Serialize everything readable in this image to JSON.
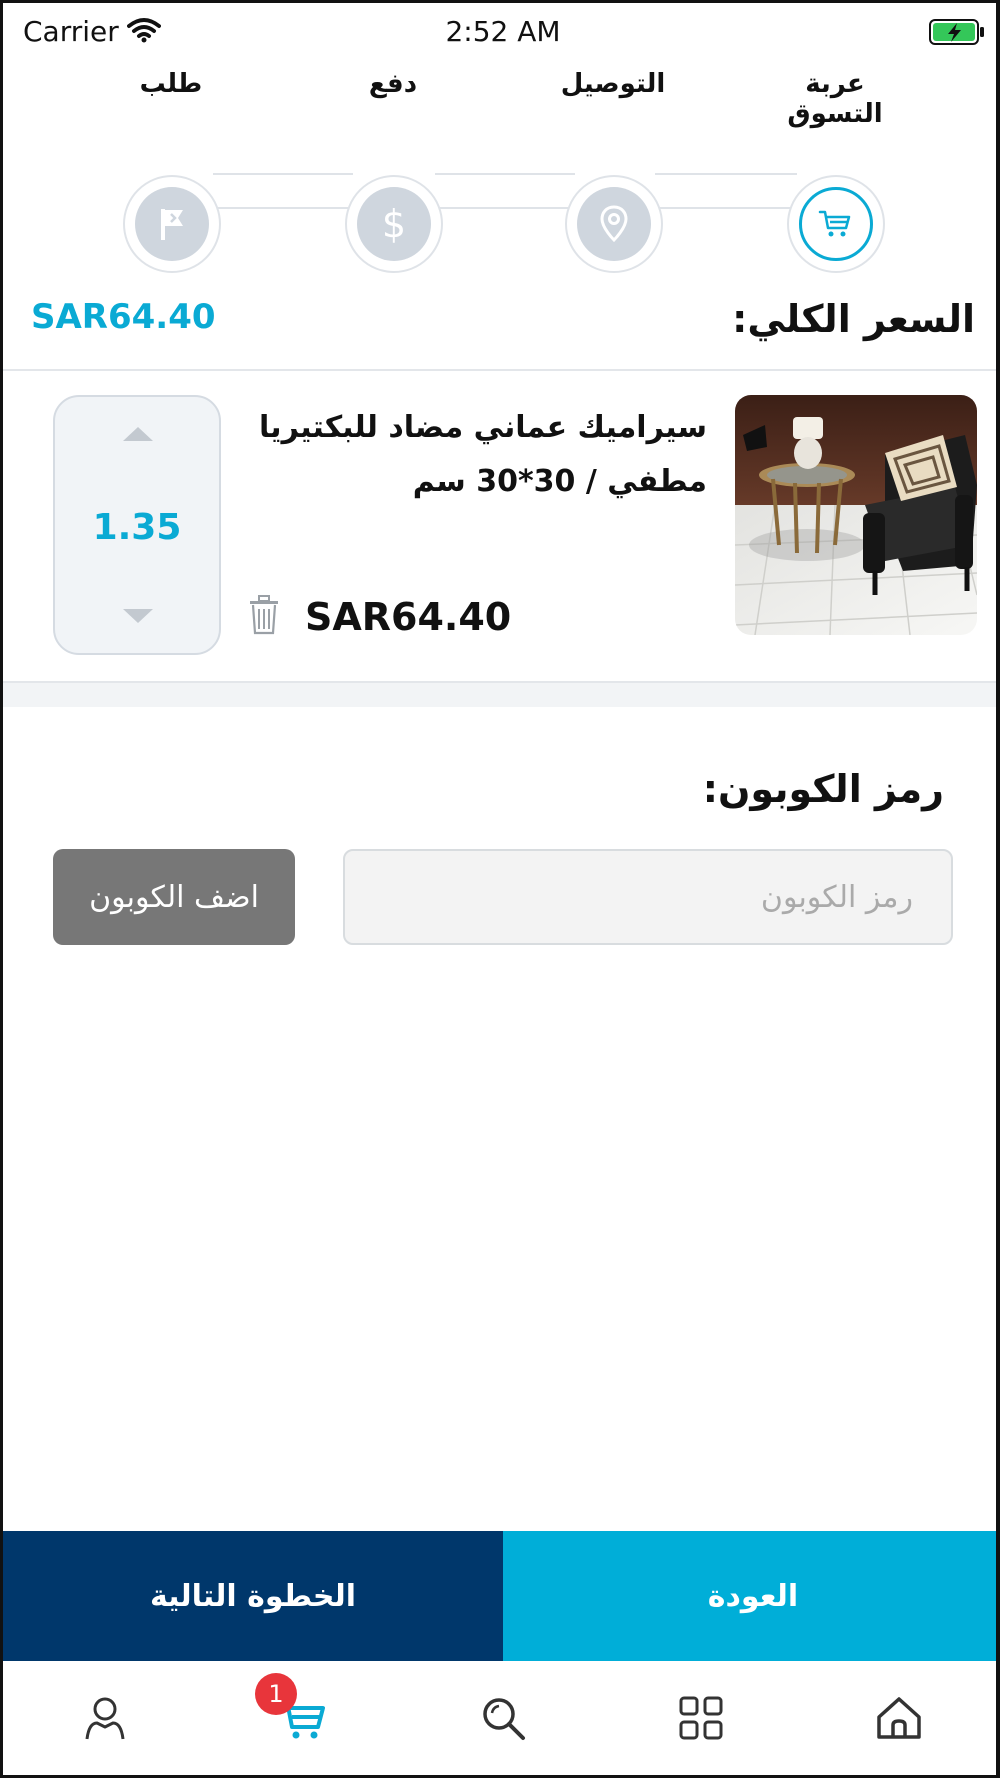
{
  "status_bar": {
    "carrier": "Carrier",
    "time": "2:52 AM"
  },
  "steps": [
    {
      "label": "عربة التسوق",
      "icon": "cart-icon",
      "active": true
    },
    {
      "label": "التوصيل",
      "icon": "location-pin-icon",
      "active": false
    },
    {
      "label": "دفع",
      "icon": "dollar-icon",
      "active": false
    },
    {
      "label": "طلب",
      "icon": "flag-icon",
      "active": false
    }
  ],
  "total": {
    "label": "السعر الكلي:",
    "value": "SAR64.40"
  },
  "cart_items": [
    {
      "name": "سيراميك عماني مضاد للبكتيريا مطفي / 30*30 سم",
      "price": "SAR64.40",
      "quantity": "1.35"
    }
  ],
  "coupon": {
    "title": "رمز الكوبون:",
    "placeholder": "رمز الكوبون",
    "value": "",
    "button_label": "اضف الكوبون"
  },
  "actions": {
    "next_label": "الخطوة التالية",
    "back_label": "العودة"
  },
  "tab_bar": {
    "items": [
      "profile-icon",
      "cart-icon",
      "search-icon",
      "categories-icon",
      "home-icon"
    ],
    "cart_badge": "1"
  },
  "colors": {
    "accent": "#0aaad4",
    "next_button": "#00376b",
    "back_button": "#00aed8",
    "badge": "#e8353b"
  }
}
